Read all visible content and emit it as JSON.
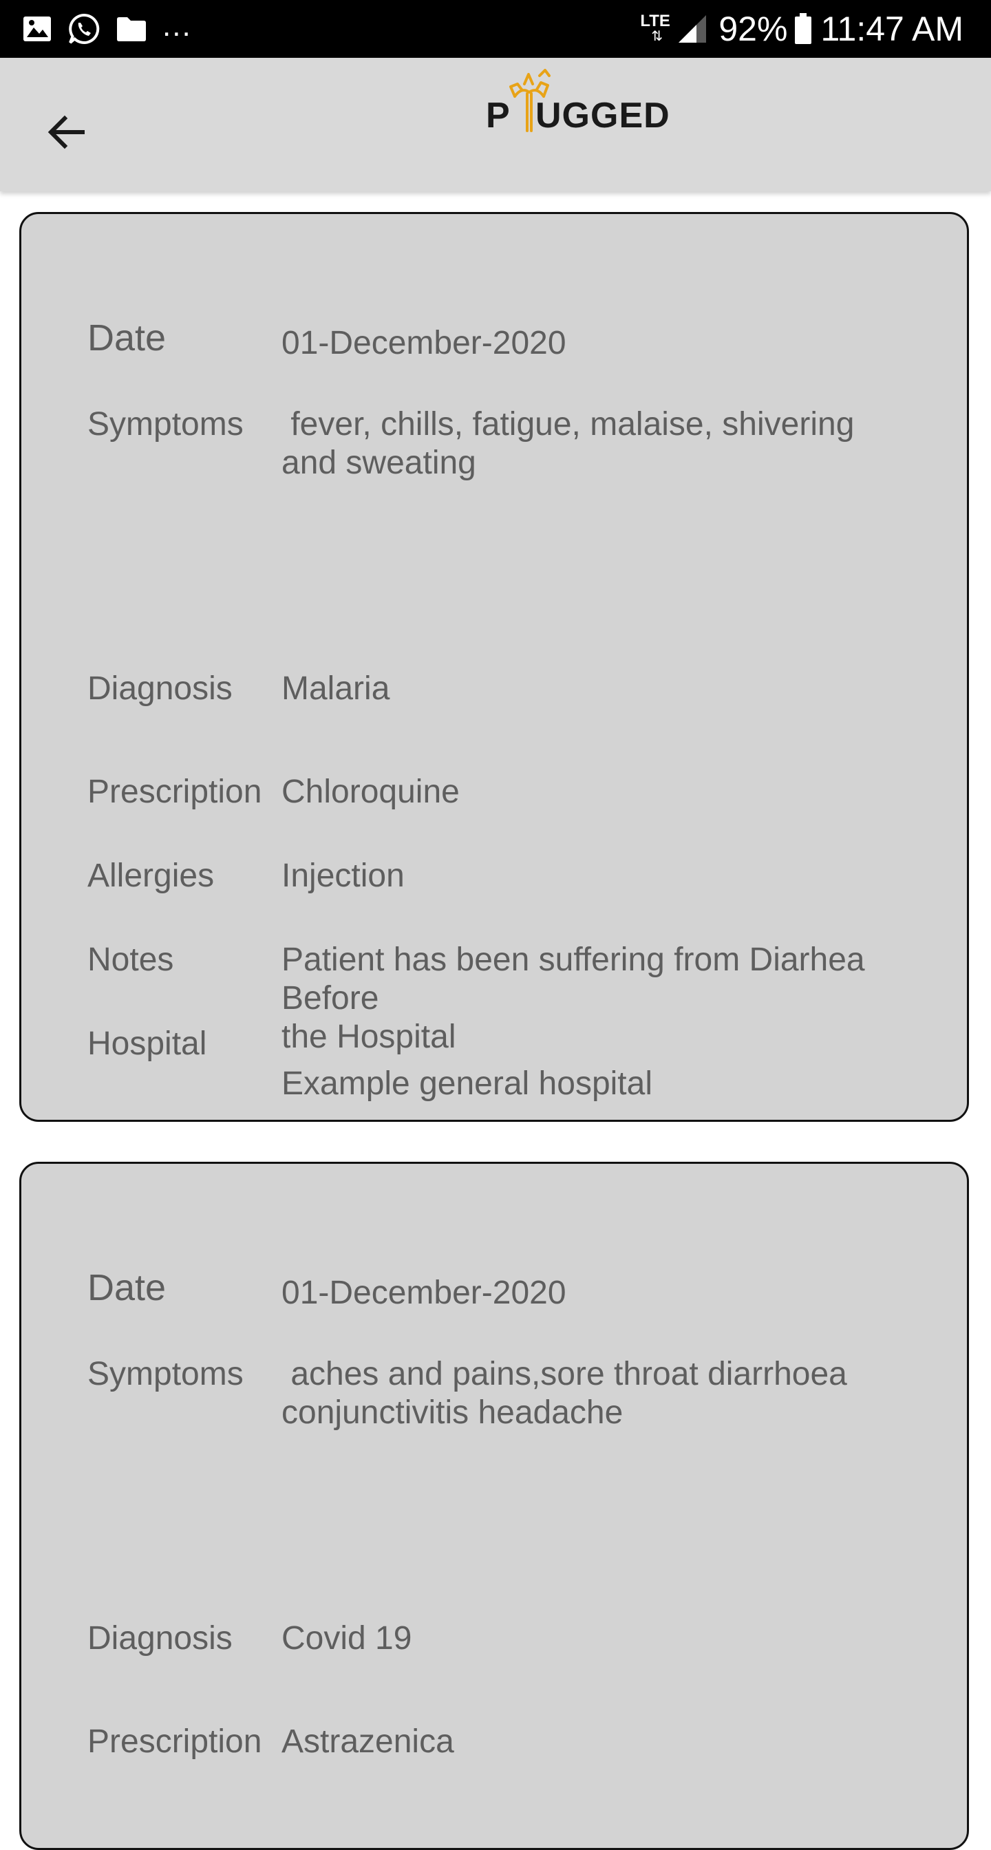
{
  "status_bar": {
    "icons": [
      "image-icon",
      "whatsapp-icon",
      "folder-icon"
    ],
    "overflow": "...",
    "network": "LTE",
    "battery": "92%",
    "time": "11:47 AM"
  },
  "app_bar": {
    "back_icon": "arrow-back-icon",
    "logo_text_left": "P",
    "logo_text_right": "UGGED",
    "logo_accent": "#e8a317"
  },
  "labels": {
    "date": "Date",
    "symptoms": "Symptoms",
    "diagnosis": "Diagnosis",
    "prescription": "Prescription",
    "allergies": "Allergies",
    "notes": "Notes",
    "hospital": "Hospital"
  },
  "records": [
    {
      "date": "01-December-2020",
      "symptoms": " fever, chills, fatigue, malaise, shivering\nand sweating",
      "diagnosis": "Malaria",
      "prescription": "Chloroquine",
      "allergies": "Injection",
      "notes": "Patient has been suffering from Diarhea Before\nthe Hospital",
      "hospital": "Example general hospital"
    },
    {
      "date": "01-December-2020",
      "symptoms": " aches and pains,sore throat diarrhoea\nconjunctivitis headache",
      "diagnosis": "Covid 19",
      "prescription": "Astrazenica"
    }
  ]
}
